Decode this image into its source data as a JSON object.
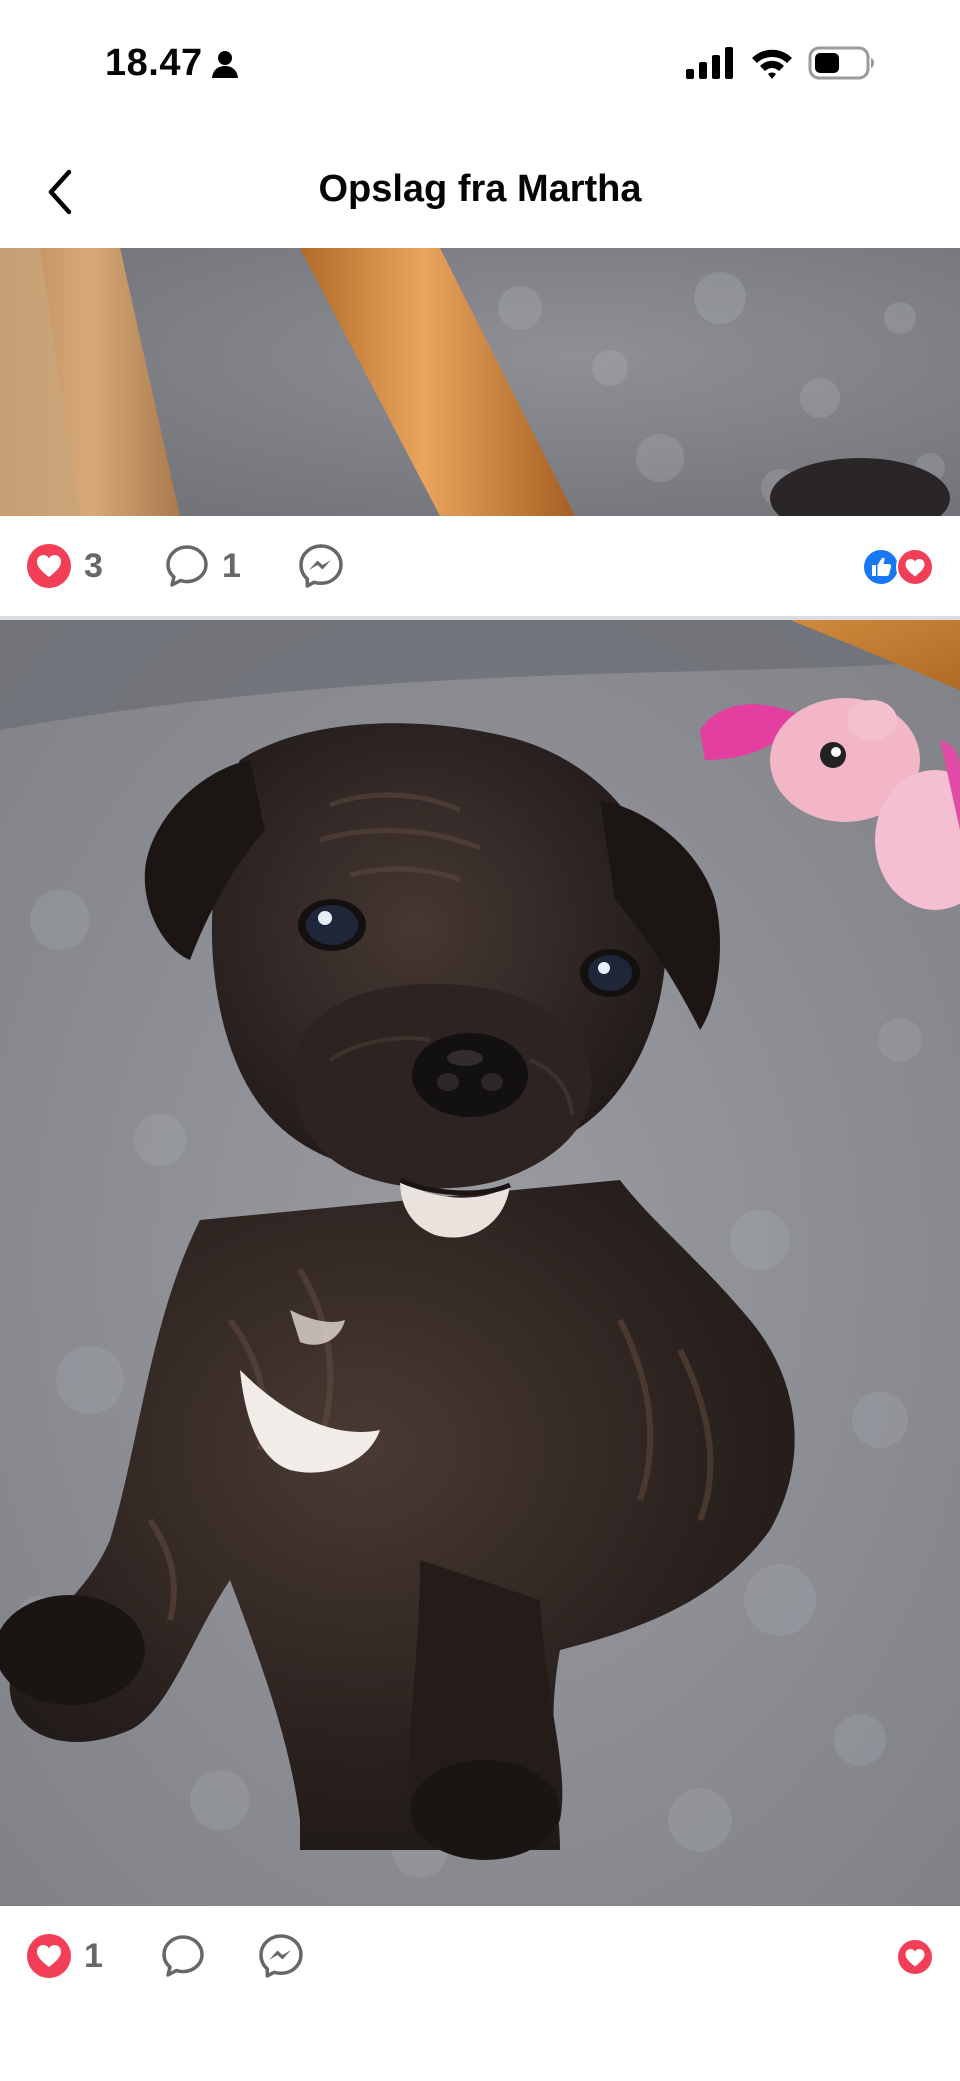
{
  "status_bar": {
    "time": "18.47",
    "icons": [
      "person-icon",
      "cellular-signal-icon",
      "wifi-icon",
      "battery-icon"
    ]
  },
  "header": {
    "title": "Opslag fra Martha",
    "back_icon": "chevron-left-icon"
  },
  "posts": [
    {
      "photo_description_icon": "photo",
      "reactions": {
        "heart_count": "3",
        "comment_count": "1"
      },
      "reaction_summary": [
        "like-icon",
        "love-icon"
      ]
    },
    {
      "photo_description_icon": "photo",
      "reactions": {
        "heart_count": "1",
        "comment_count": ""
      },
      "reaction_summary": [
        "love-icon"
      ]
    }
  ],
  "colors": {
    "heart_red": "#f33e58",
    "like_blue": "#1877f2",
    "icon_gray": "#65676b",
    "divider": "#dadde1"
  }
}
